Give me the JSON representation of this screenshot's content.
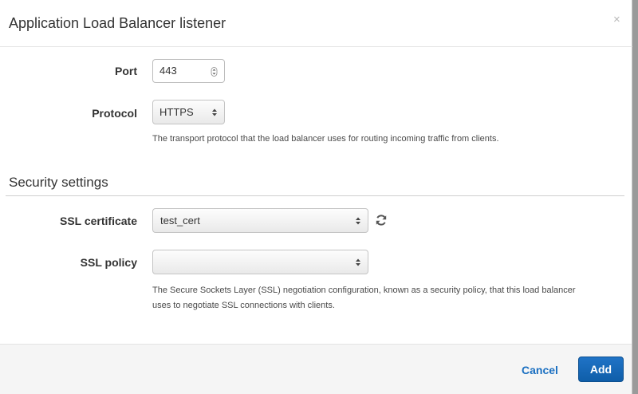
{
  "dialog": {
    "title": "Application Load Balancer listener",
    "close_glyph": "×"
  },
  "listener": {
    "port_label": "Port",
    "port_value": "443",
    "protocol_label": "Protocol",
    "protocol_value": "HTTPS",
    "protocol_help": "The transport protocol that the load balancer uses for routing incoming traffic from clients."
  },
  "security": {
    "section_title": "Security settings",
    "ssl_cert_label": "SSL certificate",
    "ssl_cert_value": "test_cert",
    "ssl_policy_label": "SSL policy",
    "ssl_policy_value": "",
    "ssl_policy_help_line1": "The Secure Sockets Layer (SSL) negotiation configuration, known as a security policy, that this load balancer",
    "ssl_policy_help_line2": "uses to negotiate SSL connections with clients."
  },
  "footer": {
    "cancel_label": "Cancel",
    "add_label": "Add"
  },
  "icons": {
    "refresh": "refresh-icon",
    "select_arrows": "updown-arrows-icon",
    "close": "close-icon"
  },
  "colors": {
    "primary_button": "#1767b8",
    "link": "#1a6fc1"
  }
}
